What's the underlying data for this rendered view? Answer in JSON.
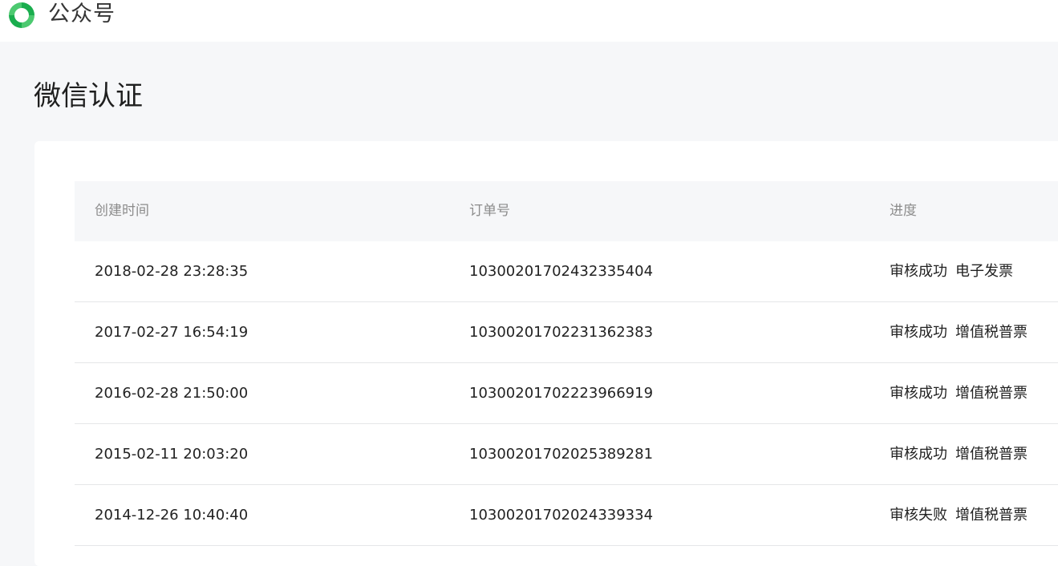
{
  "header": {
    "brand": "公众号",
    "logo_icon": "wechat-official-account-logo-icon",
    "colors": {
      "logo_green_dark": "#1aad4e",
      "logo_green_light": "#4cc970"
    }
  },
  "page": {
    "title": "微信认证"
  },
  "table": {
    "columns": [
      "创建时间",
      "订单号",
      "进度"
    ],
    "rows": [
      {
        "created": "2018-02-28 23:28:35",
        "order_no": "10300201702432335404",
        "status": "审核成功",
        "invoice": "电子发票"
      },
      {
        "created": "2017-02-27 16:54:19",
        "order_no": "10300201702231362383",
        "status": "审核成功",
        "invoice": "增值税普票"
      },
      {
        "created": "2016-02-28 21:50:00",
        "order_no": "10300201702223966919",
        "status": "审核成功",
        "invoice": "增值税普票"
      },
      {
        "created": "2015-02-11 20:03:20",
        "order_no": "10300201702025389281",
        "status": "审核成功",
        "invoice": "增值税普票"
      },
      {
        "created": "2014-12-26 10:40:40",
        "order_no": "10300201702024339334",
        "status": "审核失败",
        "invoice": "增值税普票"
      }
    ]
  }
}
